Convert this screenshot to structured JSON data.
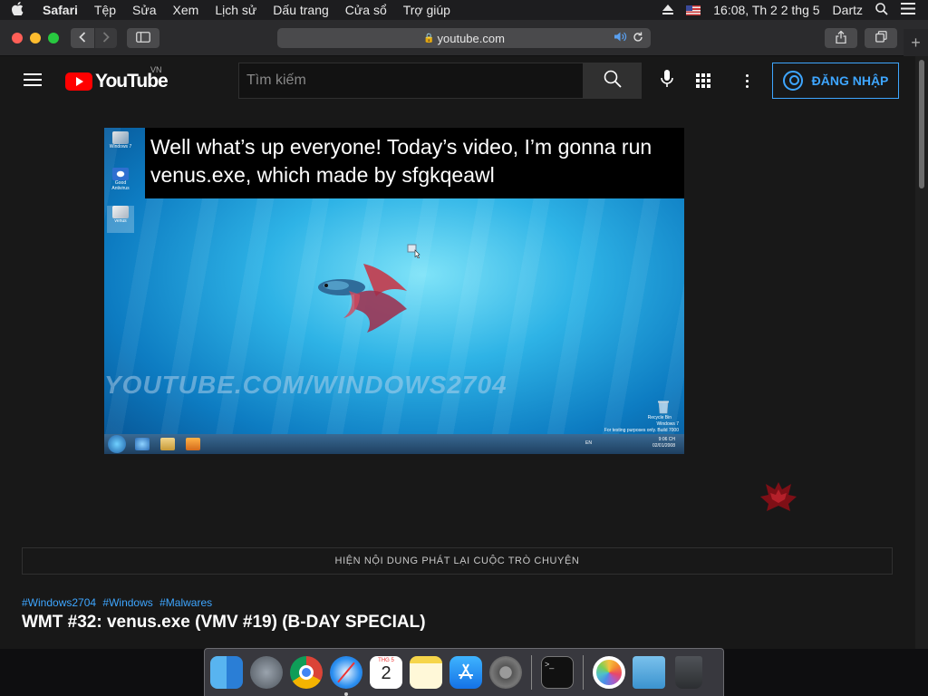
{
  "menubar": {
    "apple": "",
    "items": [
      "Safari",
      "Tệp",
      "Sửa",
      "Xem",
      "Lịch sử",
      "Dấu trang",
      "Cửa sổ",
      "Trợ giúp"
    ],
    "clock": "16:08, Th 2 2 thg 5",
    "user": "Dartz"
  },
  "browser": {
    "url": "youtube.com",
    "lock": "🔒",
    "new_tab": "+"
  },
  "youtube": {
    "logo_text": "YouTube",
    "country_code": "VN",
    "search_placeholder": "Tìm kiếm",
    "signin_label": "ĐĂNG NHẬP",
    "video": {
      "caption_line1": "Well what’s up everyone! Today’s video, I’m gonna run",
      "caption_line2": "venus.exe, which made by sfgkqeawl",
      "watermark": "YOUTUBE.COM/WINDOWS2704",
      "desktop_icons": [
        "Windows 7",
        "Good Antivirus",
        "venus"
      ],
      "recycle_bin_label": "Recycle Bin",
      "windows_note_1": "Windows 7",
      "windows_note_2": "For testing purposes only. Build 7000",
      "tray_lang": "EN",
      "tray_time": "9:06 CH",
      "tray_date": "02/01/2008"
    },
    "chat_replay_label": "HIỆN NỘI DUNG PHÁT LẠI CUỘC TRÒ CHUYỆN",
    "hashtags": [
      "#Windows2704",
      "#Windows",
      "#Malwares"
    ],
    "video_title": "WMT #32: venus.exe (VMV #19) (B-DAY SPECIAL)"
  },
  "dock": {
    "apps": [
      "finder-icon",
      "launchpad-icon",
      "chrome-icon",
      "safari-icon",
      "calendar-icon",
      "notes-icon",
      "app-store-icon",
      "system-preferences-icon",
      "terminal-icon",
      "photos-icon",
      "downloads-folder-icon",
      "trash-icon"
    ],
    "calendar_day": "2",
    "calendar_month": "THG 5",
    "terminal_prompt": ">_"
  }
}
